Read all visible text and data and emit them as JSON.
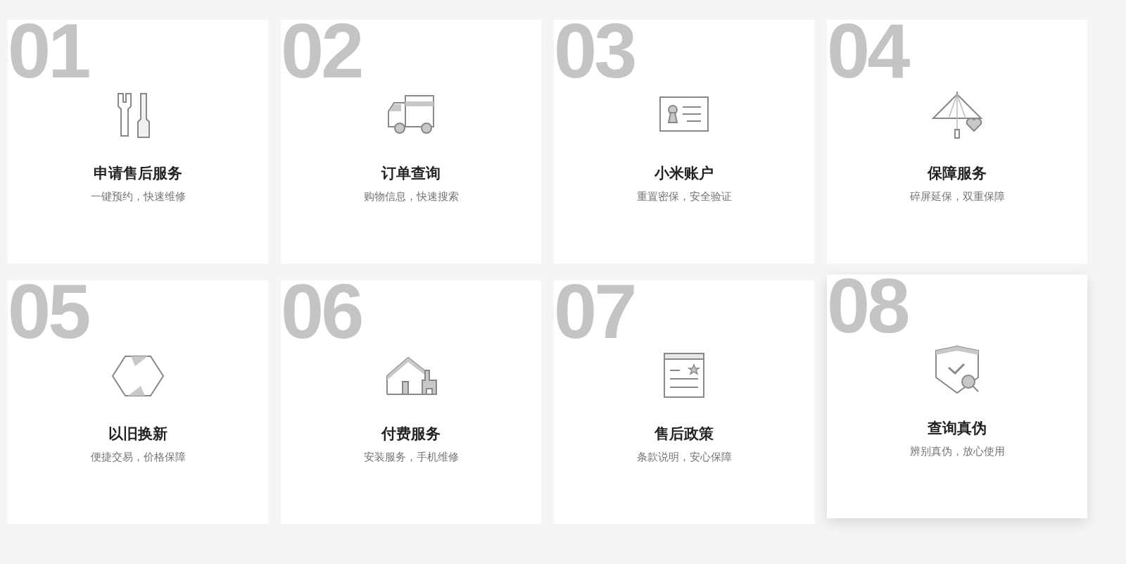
{
  "cards": [
    {
      "number": "01",
      "title": "申请售后服务",
      "subtitle": "一键预约，快速维修",
      "hovered": false
    },
    {
      "number": "02",
      "title": "订单查询",
      "subtitle": "购物信息，快速搜索",
      "hovered": false
    },
    {
      "number": "03",
      "title": "小米账户",
      "subtitle": "重置密保，安全验证",
      "hovered": false
    },
    {
      "number": "04",
      "title": "保障服务",
      "subtitle": "碎屏延保，双重保障",
      "hovered": false
    },
    {
      "number": "05",
      "title": "以旧换新",
      "subtitle": "便捷交易，价格保障",
      "hovered": false
    },
    {
      "number": "06",
      "title": "付费服务",
      "subtitle": "安装服务，手机维修",
      "hovered": false
    },
    {
      "number": "07",
      "title": "售后政策",
      "subtitle": "条款说明，安心保障",
      "hovered": false
    },
    {
      "number": "08",
      "title": "查询真伪",
      "subtitle": "辨别真伪，放心使用",
      "hovered": true
    }
  ]
}
